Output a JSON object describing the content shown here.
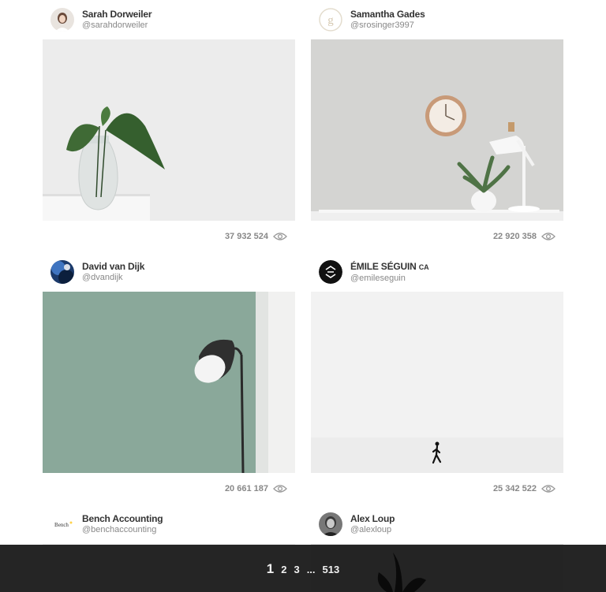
{
  "cards": [
    {
      "name": "Sarah Dorweiler",
      "handle": "@sarahdorweiler",
      "views": "37 932 524"
    },
    {
      "name": "Samantha Gades",
      "handle": "@srosinger3997",
      "views": "22 920 358"
    },
    {
      "name": "David van Dijk",
      "handle": "@dvandijk",
      "views": "20 661 187"
    },
    {
      "name": "ÉMILE SÉGUIN",
      "badge": "CA",
      "handle": "@emileseguin",
      "views": "25 342 522"
    },
    {
      "name": "Bench Accounting",
      "handle": "@benchaccounting",
      "logo_text": "Bench"
    },
    {
      "name": "Alex Loup",
      "handle": "@alexloup"
    }
  ],
  "pagination": {
    "pages": [
      "1",
      "2",
      "3",
      "...",
      "513"
    ],
    "current": "1"
  },
  "icons": {
    "views": "eye-icon"
  },
  "colors": {
    "pager_bg": "#1c1c1c",
    "text": "#333333",
    "muted": "#888888"
  }
}
